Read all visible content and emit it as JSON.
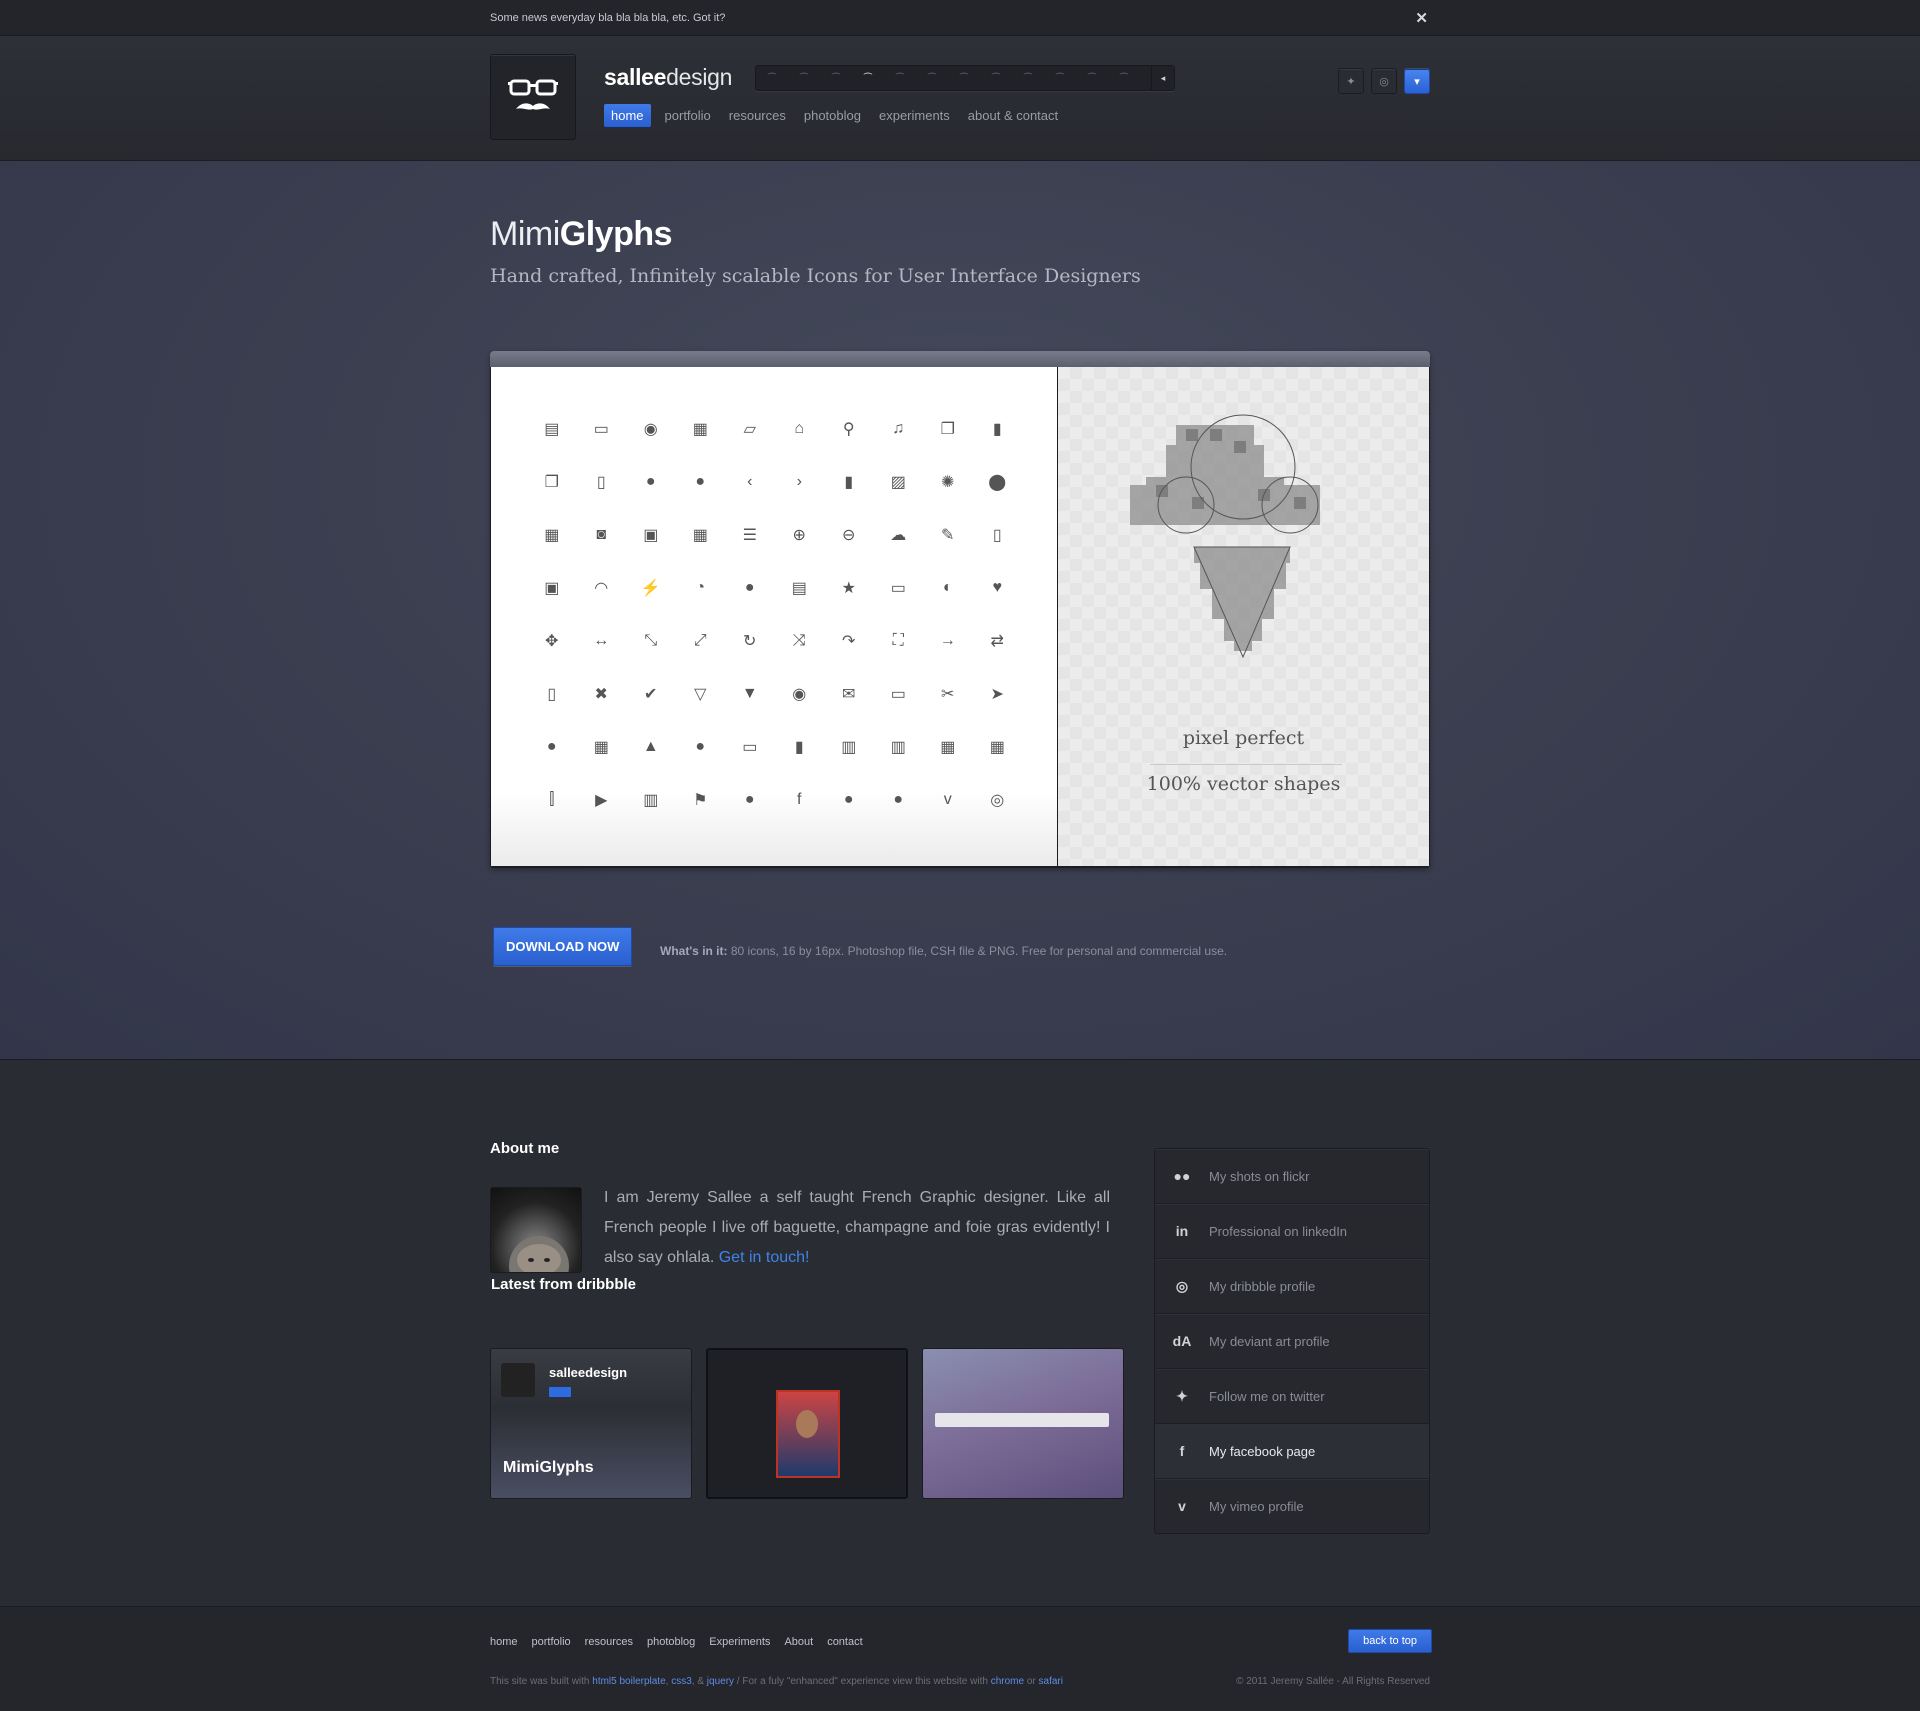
{
  "newsbar": {
    "text": "Some news everyday bla bla bla bla, etc. Got it?",
    "close": "✕"
  },
  "header": {
    "brand_bold": "sallee",
    "brand_light": "design",
    "nav": [
      "home",
      "portfolio",
      "resources",
      "photoblog",
      "experiments",
      "about & contact"
    ],
    "active_nav": "home",
    "mustache_count": 12,
    "mustache_active_index": 3,
    "strip_arrow": "◂",
    "icons": [
      "twitter-icon",
      "dribbble-icon",
      "dropdown-icon"
    ]
  },
  "hero": {
    "title_light": "Mimi",
    "title_bold": "Glyphs",
    "subtitle": "Hand crafted, Infinitely scalable Icons for User Interface Designers",
    "pixel_perfect": "pixel perfect",
    "vector": "100% vector shapes",
    "download_label": "DOWNLOAD NOW",
    "info_label": "What's in it:",
    "info_text": " 80 icons, 16 by 16px. Photoshop file, CSH file & PNG. Free for personal and commercial use.",
    "glyphs": [
      "▤",
      "▭",
      "◉",
      "▦",
      "▱",
      "⌂",
      "⚲",
      "♫",
      "❐",
      "▮",
      "❐",
      "▯",
      "●",
      "●",
      "‹",
      "›",
      "▮",
      "▨",
      "✺",
      "⬤",
      "▦",
      "◙",
      "▣",
      "▦",
      "☰",
      "⊕",
      "⊖",
      "☁",
      "✎",
      "▯",
      "▣",
      "◠",
      "⚡",
      "◔",
      "●",
      "▤",
      "★",
      "▭",
      "◐",
      "♥",
      "✥",
      "↔",
      "⤡",
      "⤢",
      "↻",
      "⤨",
      "↷",
      "⛶",
      "→",
      "⇄",
      "▯",
      "✖",
      "✔",
      "▽",
      "▼",
      "◉",
      "✉",
      "▭",
      "✂",
      "➤",
      "●",
      "▦",
      "▲",
      "●",
      "▭",
      "▮",
      "▥",
      "▥",
      "▦",
      "▦",
      "⫿",
      "▶",
      "▥",
      "⚑",
      "●",
      "f",
      "●",
      "●",
      "v",
      "◎"
    ]
  },
  "about": {
    "title": "About me",
    "text": "I am Jeremy Sallee a self taught French Graphic designer. Like all French people I live off baguette, champagne and foie gras evidently! I also say ohlala. ",
    "link": "Get in touch!"
  },
  "dribbble": {
    "title": "Latest from dribbble",
    "shot1_title": "MimiGlyphs"
  },
  "social": [
    {
      "icon": "flickr-icon",
      "glyph": "●●",
      "label": "My shots on flickr"
    },
    {
      "icon": "linkedin-icon",
      "glyph": "in",
      "label": "Professional on linkedIn"
    },
    {
      "icon": "dribbble-icon",
      "glyph": "◎",
      "label": "My dribbble profile"
    },
    {
      "icon": "deviantart-icon",
      "glyph": "dA",
      "label": "My deviant art profile"
    },
    {
      "icon": "twitter-icon",
      "glyph": "✦",
      "label": "Follow me on twitter"
    },
    {
      "icon": "facebook-icon",
      "glyph": "f",
      "label": "My facebook page"
    },
    {
      "icon": "vimeo-icon",
      "glyph": "v",
      "label": "My vimeo profile"
    }
  ],
  "footer": {
    "nav": [
      "home",
      "portfolio",
      "resources",
      "photoblog",
      "Experiments",
      "About",
      "contact"
    ],
    "back_to_top": "back to top",
    "meta_prefix": "This site was built with ",
    "meta_links": [
      "html5 boilerplate",
      "css3",
      "jquery",
      "chrome",
      "safari"
    ],
    "meta_sep1": ", ",
    "meta_sep2": ", & ",
    "meta_mid": " / For a fuly \"enhanced\" experience view this website with ",
    "meta_or": " or ",
    "copyright": "© 2011 Jeremy Sallée - All Rights Reserved"
  },
  "colors": {
    "accent": "#2f6be0",
    "bg": "#2a2c33",
    "hero": "#3b3f50"
  }
}
